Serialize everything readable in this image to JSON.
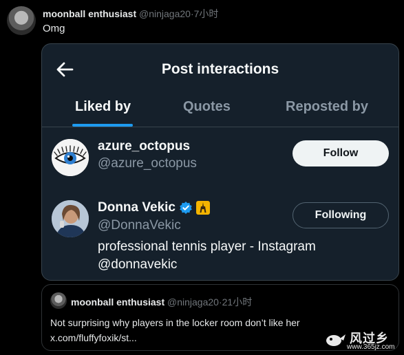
{
  "tweet": {
    "author_name": "moonball enthusiast",
    "author_handle": "@ninjaga20",
    "time": "7小时",
    "text": "Omg"
  },
  "screenshot": {
    "title": "Post interactions",
    "tabs": [
      {
        "label": "Liked by",
        "active": true
      },
      {
        "label": "Quotes",
        "active": false
      },
      {
        "label": "Reposted by",
        "active": false
      }
    ],
    "users": [
      {
        "name": "azure_octopus",
        "handle": "@azure_octopus",
        "button": "Follow"
      },
      {
        "name": "Donna Vekic",
        "handle": "@DonnaVekic",
        "button": "Following",
        "bio": "professional tennis player - Instagram @donnavekic",
        "badges": [
          "verified-icon",
          "eiffel-tower-emoji"
        ]
      }
    ],
    "colors": {
      "accent": "#1d9bf0",
      "card_bg": "#15202b"
    }
  },
  "quote": {
    "author_name": "moonball enthusiast",
    "author_handle": "@ninjaga20",
    "time": "21小时",
    "text": "Not surprising why players in the locker room don’t like her x.com/fluffyfoxik/st..."
  },
  "watermark": {
    "text": "风过乡",
    "sub": "www.365jz.com"
  }
}
